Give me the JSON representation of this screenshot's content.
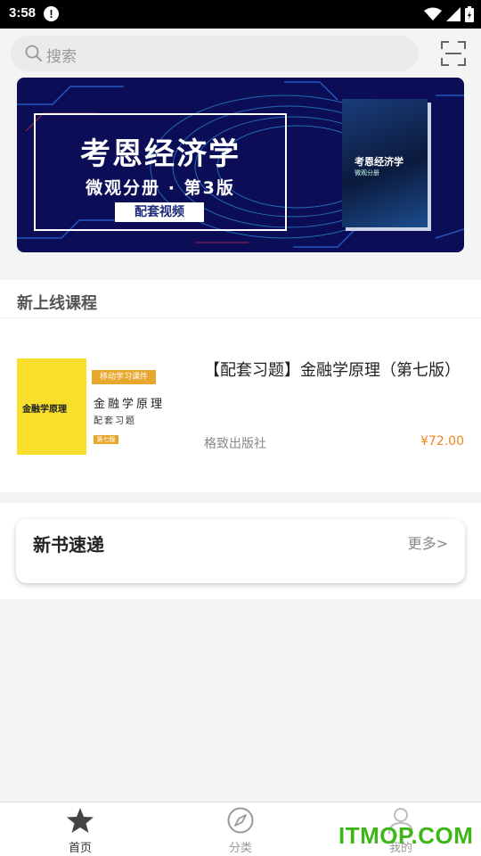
{
  "status_bar": {
    "time": "3:58",
    "alert": "!"
  },
  "search": {
    "placeholder": "搜索"
  },
  "banner": {
    "title": "考恩经济学",
    "subtitle": "微观分册 · 第3版",
    "badge": "配套视频",
    "book_title": "考恩经济学",
    "book_subtitle": "微观分册"
  },
  "new_courses": {
    "title": "新上线课程",
    "items": [
      {
        "cover_tag": "移动学习课件",
        "cover_title": "金融学原理",
        "cover_subtitle": "配套习题",
        "cover_edition": "第七版",
        "cover_spine": "金融学原理",
        "title": "【配套习题】金融学原理（第七版）",
        "publisher": "格致出版社",
        "price": "¥72.00"
      }
    ]
  },
  "new_books": {
    "title": "新书速递",
    "more": "更多>"
  },
  "bottom_nav": [
    {
      "label": "首页",
      "icon": "star-icon",
      "active": true
    },
    {
      "label": "分类",
      "icon": "compass-icon",
      "active": false
    },
    {
      "label": "我的",
      "icon": "person-icon",
      "active": false
    }
  ],
  "watermark": "ITMOP.COM",
  "colors": {
    "accent_price": "#f08519",
    "active_nav": "#333333",
    "inactive_nav": "#9a9a9a",
    "watermark": "#3fb618",
    "banner_bg": "#0c0d57"
  }
}
